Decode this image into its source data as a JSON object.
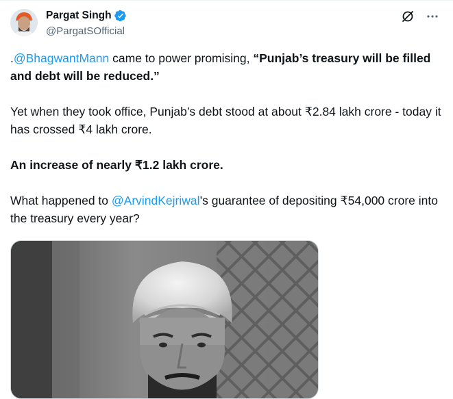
{
  "author": {
    "display_name": "Pargat Singh",
    "handle": "@PargatSOfficial",
    "verified": true,
    "verified_color": "#1d9bf0"
  },
  "actions": {
    "grok_icon": "grok-icon",
    "more_icon": "more-horizontal-icon"
  },
  "tweet": {
    "p1_prefix": ".",
    "p1_mention": "@BhagwantMann",
    "p1_text": " came to power promising, ",
    "p1_bold": "“Punjab’s treasury will be filled and debt will be reduced.”",
    "p2": "Yet when they took office, Punjab’s debt stood at about ₹2.84 lakh crore - today it has crossed ₹4 lakh crore.",
    "p3": "An increase of nearly ₹1.2 lakh crore.",
    "p4_prefix": "What happened to ",
    "p4_mention": "@ArvindKejriwal",
    "p4_suffix": "’s guarantee of depositing ₹54,000 crore into the treasury every year?"
  },
  "colors": {
    "link": "#1d9bf0",
    "text": "#0f1419",
    "secondary": "#536471"
  }
}
